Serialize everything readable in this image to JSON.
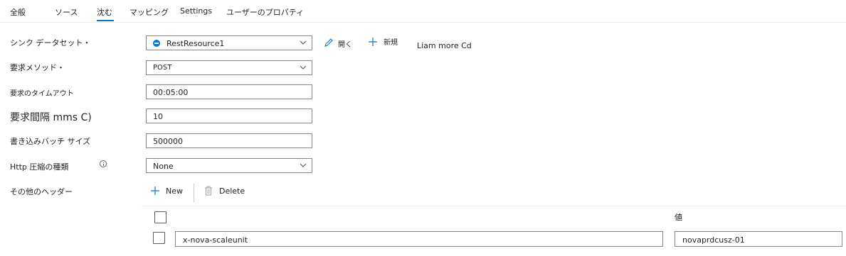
{
  "tabs": [
    {
      "label": "全般"
    },
    {
      "label": "ソース"
    },
    {
      "label": "沈む"
    },
    {
      "label": "マッピング"
    },
    {
      "label": "Settings"
    },
    {
      "label": "ユーザーのプロパティ"
    }
  ],
  "active_tab": "沈む",
  "colors": {
    "accent": "#0078d4",
    "border": "#8a8886",
    "text": "#201f1e"
  },
  "form": {
    "sink_dataset": {
      "label": "シンク データセット・",
      "value": "RestResource1",
      "open_label": "開く",
      "new_label": "新規",
      "extra_text": "Liam more Cd"
    },
    "request_method": {
      "label": "要求メソッド・",
      "value": "POST"
    },
    "request_timeout": {
      "label": "要求のタイムアウト",
      "value": "00:05:00"
    },
    "request_interval": {
      "label": "要求間隔 mms C)",
      "value": "10"
    },
    "write_batch_size": {
      "label": "書き込みバッチ サイズ",
      "value": "500000"
    },
    "http_compression": {
      "label": "Http 圧縮の種類",
      "value": "None"
    },
    "additional_headers": {
      "label": "その他のヘッダー"
    }
  },
  "headers_toolbar": {
    "new_label": "New",
    "delete_label": "Delete"
  },
  "headers_table": {
    "value_column": "値",
    "rows": [
      {
        "name": "x-nova-scaleunit",
        "value": "novaprdcusz-01"
      }
    ]
  }
}
